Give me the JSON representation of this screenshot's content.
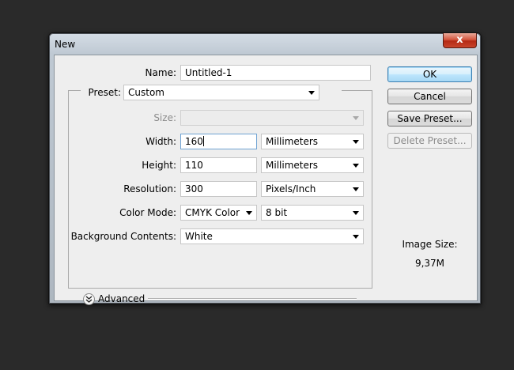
{
  "window": {
    "title": "New",
    "close_label": "x"
  },
  "form": {
    "name_label": "Name:",
    "name_value": "Untitled-1",
    "preset_label": "Preset:",
    "preset_value": "Custom",
    "size_label": "Size:",
    "size_value": "",
    "width_label": "Width:",
    "width_value": "160",
    "width_unit": "Millimeters",
    "height_label": "Height:",
    "height_value": "110",
    "height_unit": "Millimeters",
    "resolution_label": "Resolution:",
    "resolution_value": "300",
    "resolution_unit": "Pixels/Inch",
    "color_mode_label": "Color Mode:",
    "color_mode_value": "CMYK Color",
    "bit_depth_value": "8 bit",
    "background_label": "Background Contents:",
    "background_value": "White",
    "advanced_label": "Advanced"
  },
  "buttons": {
    "ok": "OK",
    "cancel": "Cancel",
    "save_preset": "Save Preset...",
    "delete_preset": "Delete Preset..."
  },
  "image_size": {
    "label": "Image Size:",
    "value": "9,37M"
  },
  "colors": {
    "desktop": "#2a2a2a",
    "dialog_face": "#eeeeee",
    "focus_border": "#6fa3d3",
    "default_button": "#bee6fd",
    "close_button": "#c8452c"
  },
  "icons": {
    "close": "close-icon",
    "dropdown": "chevron-down-icon",
    "advanced": "double-chevron-down-icon"
  }
}
